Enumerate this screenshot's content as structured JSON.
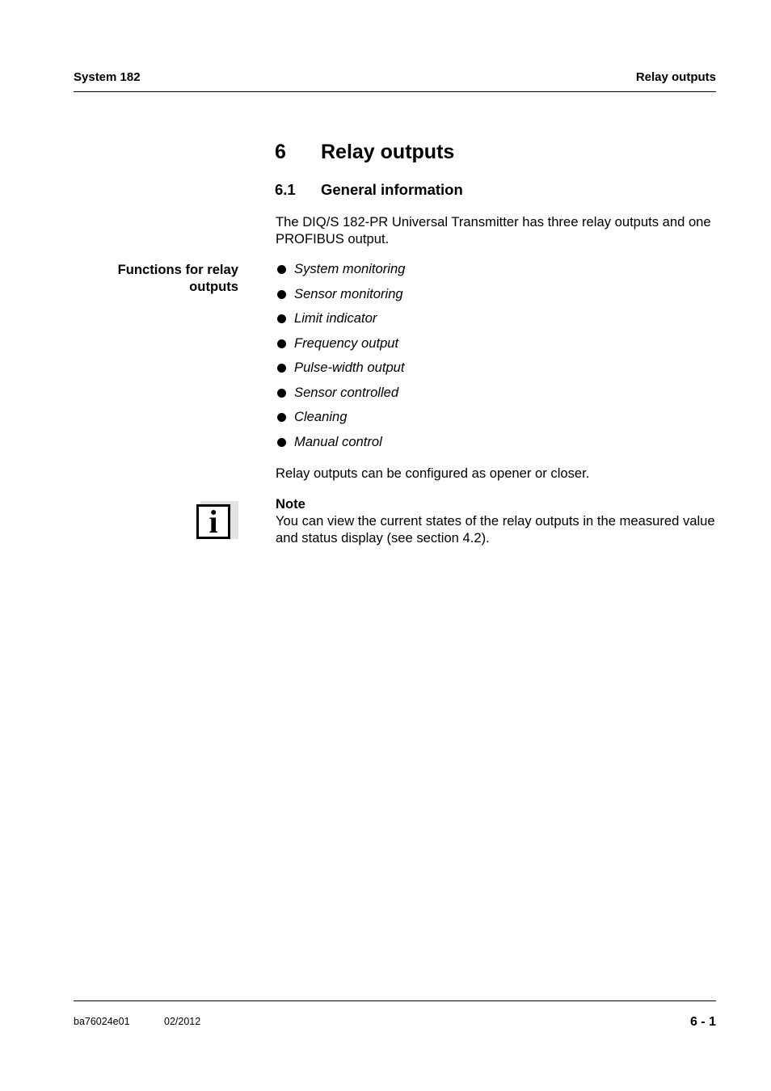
{
  "header": {
    "left": "System 182",
    "right": "Relay outputs"
  },
  "chapter": {
    "number": "6",
    "title": "Relay outputs"
  },
  "section": {
    "number": "6.1",
    "title": "General information"
  },
  "intro": "The DIQ/S 182-PR Universal Transmitter has three relay outputs and one PROFIBUS output.",
  "functions": {
    "margin_label": "Functions for relay outputs",
    "items": [
      "System monitoring",
      "Sensor monitoring",
      "Limit indicator",
      "Frequency output",
      "Pulse-width output",
      "Sensor controlled",
      "Cleaning",
      "Manual control"
    ]
  },
  "closing": "Relay outputs can be configured as opener or closer.",
  "note": {
    "icon": "info-icon",
    "icon_glyph": "i",
    "title": "Note",
    "body": "You can view the current states of the relay outputs in the measured value and status display (see section 4.2)."
  },
  "footer": {
    "doc_code": "ba76024e01",
    "date": "02/2012",
    "page": "6 - 1"
  }
}
